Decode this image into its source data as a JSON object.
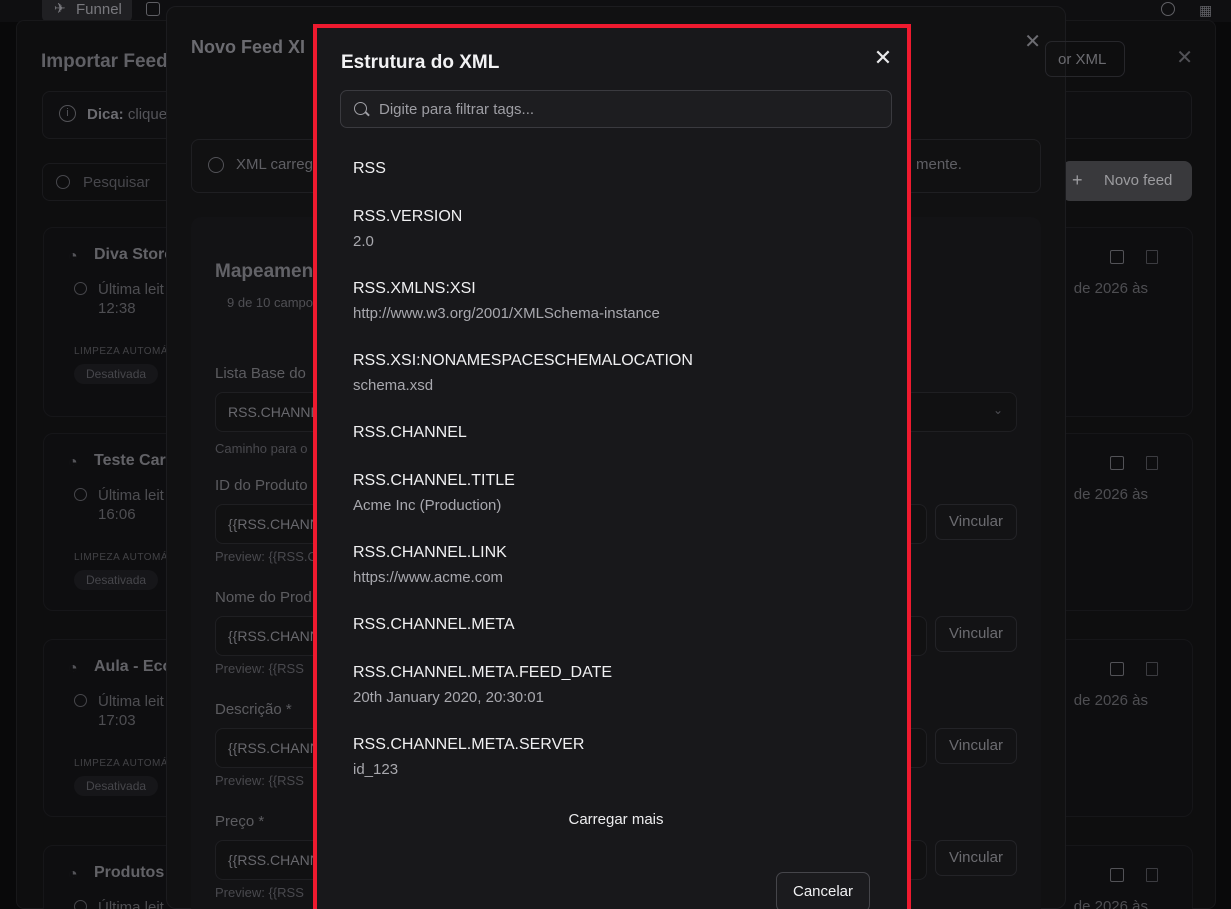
{
  "topbar": {
    "tab_label": "Funnel"
  },
  "import_modal": {
    "title": "Importar Feed",
    "tip_bold": "Dica:",
    "tip_text": "clique",
    "search_placeholder": "Pesquisar",
    "new_feed_label": "Novo feed",
    "cards": [
      {
        "name": "Diva Store",
        "last_read": "Última leit",
        "time": "12:38",
        "date": "de 2026 às",
        "clean_label": "LIMPEZA AUTOMÁ",
        "status": "Desativada"
      },
      {
        "name": "Teste Car",
        "last_read": "Última leit",
        "time": "16:06",
        "date": "de 2026 às",
        "clean_label": "LIMPEZA AUTOMÁ",
        "status": "Desativada"
      },
      {
        "name": "Aula - Eco",
        "last_read": "Última leit",
        "time": "17:03",
        "date": "de 2026 às",
        "clean_label": "LIMPEZA AUTOMÁ",
        "status": "Desativada"
      },
      {
        "name": "Produtos",
        "last_read": "Última leit",
        "time": "",
        "date": "de 2026 às",
        "clean_label": "",
        "status": ""
      }
    ]
  },
  "feed_modal": {
    "title": "Novo Feed XI",
    "xml_button": "or XML",
    "loaded_msg": "XML carreg",
    "loaded_msg_end": "mente.",
    "mapping_title": "Mapeamen",
    "mapping_subtitle": "9 de 10 campo",
    "base_list_label": "Lista Base do",
    "base_list_value": "RSS.CHANNE",
    "base_list_hint": "Caminho para o",
    "fields": [
      {
        "label": "ID do Produto",
        "value": "{{RSS.CHANN",
        "preview": "Preview: {{RSS.CHANN",
        "bind": "Vincular"
      },
      {
        "label": "Nome do Prod",
        "value": "{{RSS.CHANN",
        "preview": "Preview: {{RSS",
        "bind": "Vincular"
      },
      {
        "label": "Descrição *",
        "value": "{{RSS.CHANN",
        "preview": "Preview: {{RSS",
        "bind": "Vincular"
      },
      {
        "label": "Preço *",
        "value": "{{RSS.CHANN",
        "preview": "Preview: {{RSS",
        "bind": "Vincular"
      }
    ]
  },
  "xml_modal": {
    "title": "Estrutura do XML",
    "filter_placeholder": "Digite para filtrar tags...",
    "tags": [
      {
        "name": "RSS",
        "value": ""
      },
      {
        "name": "RSS.VERSION",
        "value": "2.0"
      },
      {
        "name": "RSS.XMLNS:XSI",
        "value": "http://www.w3.org/2001/XMLSchema-instance"
      },
      {
        "name": "RSS.XSI:NONAMESPACESCHEMALOCATION",
        "value": "schema.xsd"
      },
      {
        "name": "RSS.CHANNEL",
        "value": ""
      },
      {
        "name": "RSS.CHANNEL.TITLE",
        "value": "Acme Inc (Production)"
      },
      {
        "name": "RSS.CHANNEL.LINK",
        "value": "https://www.acme.com"
      },
      {
        "name": "RSS.CHANNEL.META",
        "value": ""
      },
      {
        "name": "RSS.CHANNEL.META.FEED_DATE",
        "value": "20th January 2020, 20:30:01"
      },
      {
        "name": "RSS.CHANNEL.META.SERVER",
        "value": "id_123"
      }
    ],
    "load_more": "Carregar mais",
    "cancel": "Cancelar"
  }
}
